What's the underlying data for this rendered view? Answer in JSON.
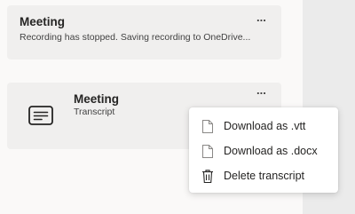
{
  "recordings": [
    {
      "title": "Meeting",
      "subtitle": "Recording has stopped. Saving recording to OneDrive...",
      "more_label": "..."
    },
    {
      "title": "Meeting",
      "subtitle": "Transcript",
      "icon": "transcript-icon",
      "more_label": "..."
    }
  ],
  "context_menu": {
    "items": [
      {
        "label": "Download as .vtt",
        "icon": "file-icon"
      },
      {
        "label": "Download as .docx",
        "icon": "file-icon"
      },
      {
        "label": "Delete transcript",
        "icon": "trash-icon"
      }
    ]
  }
}
